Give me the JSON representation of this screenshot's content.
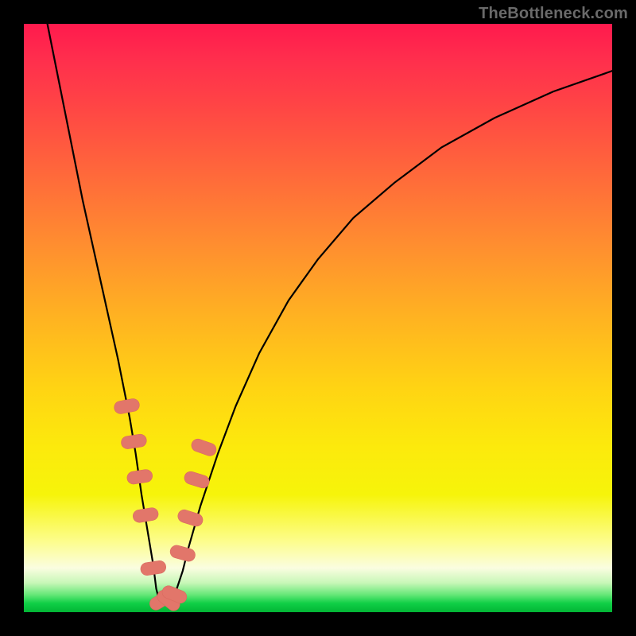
{
  "watermark": "TheBottleneck.com",
  "colors": {
    "frame": "#000000",
    "curve": "#000000",
    "marker": "#e2766a",
    "gradient_top": "#ff1a4d",
    "gradient_bottom": "#02b535"
  },
  "chart_data": {
    "type": "line",
    "title": "",
    "xlabel": "",
    "ylabel": "",
    "xlim": [
      0,
      100
    ],
    "ylim": [
      0,
      100
    ],
    "grid": false,
    "legend": false,
    "notes": "V-shaped bottleneck curve over vertical heat gradient (red=high, green=low). No axis tick labels are shown; values are approximate from pixel positions. y is plotted with 0 at bottom.",
    "series": [
      {
        "name": "bottleneck-curve",
        "x": [
          4,
          6,
          8,
          10,
          12,
          14,
          16,
          18,
          19,
          20,
          21,
          22,
          22.5,
          23,
          24,
          25,
          26,
          27,
          28,
          30,
          33,
          36,
          40,
          45,
          50,
          56,
          63,
          71,
          80,
          90,
          100
        ],
        "y": [
          100,
          90,
          80,
          70,
          61,
          52,
          43,
          33,
          27,
          20,
          14,
          8,
          4,
          2,
          1.5,
          2,
          4,
          7,
          11,
          18,
          27,
          35,
          44,
          53,
          60,
          67,
          73,
          79,
          84,
          88.5,
          92
        ]
      }
    ],
    "markers": {
      "name": "highlighted-points",
      "shape": "rounded-lozenge",
      "x": [
        17.5,
        18.7,
        19.7,
        20.7,
        22.0,
        23.4,
        24.6,
        25.6,
        27.0,
        28.3,
        29.4,
        30.6
      ],
      "y": [
        35.0,
        29.0,
        23.0,
        16.5,
        7.5,
        2.0,
        2.0,
        3.0,
        10.0,
        16.0,
        22.5,
        28.0
      ]
    }
  }
}
